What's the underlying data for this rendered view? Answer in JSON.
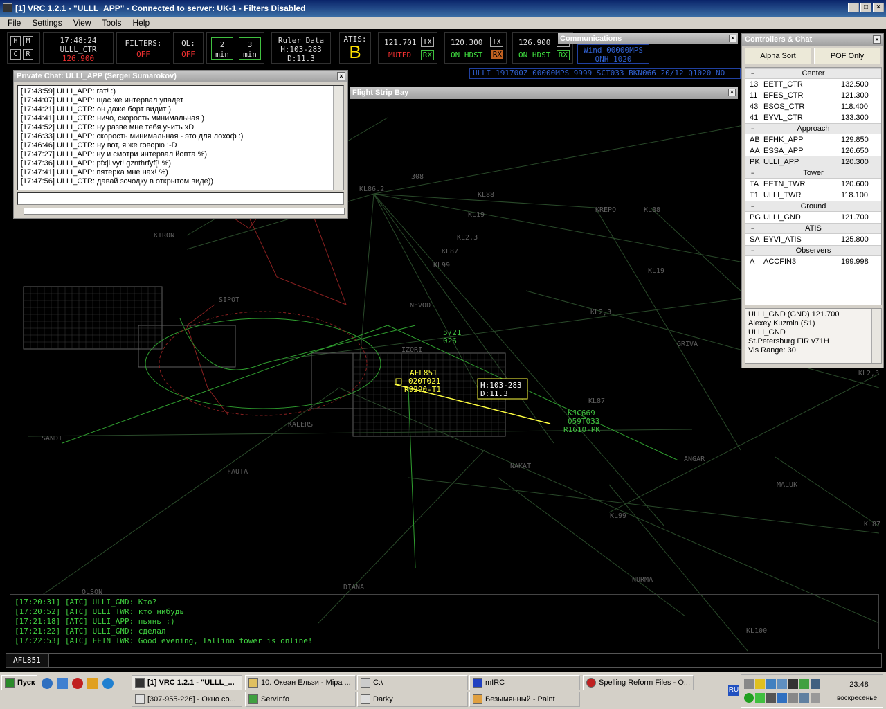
{
  "window": {
    "title": "[1] VRC 1.2.1 - \"ULLL_APP\" - Connected to server: UK-1 - Filters Disabled"
  },
  "menu": [
    "File",
    "Settings",
    "View",
    "Tools",
    "Help"
  ],
  "toolbar": {
    "keys": [
      "H",
      "M",
      "C",
      "R"
    ],
    "time": "17:48:24",
    "position": "ULLL_CTR",
    "position_freq": "126.900",
    "filters_label": "FILTERS:",
    "filters_value": "OFF",
    "ql_label": "QL:",
    "ql_value": "OFF",
    "min1": "2",
    "min1_unit": "min",
    "min2": "3",
    "min2_unit": "min",
    "ruler_label": "Ruler Data",
    "ruler_h": "H:103-283",
    "ruler_d": "D:11.3",
    "atis_label": "ATIS:",
    "atis_letter": "B",
    "freq1": "121.701",
    "freq1_status": "MUTED",
    "freq1_tx": "TX",
    "freq1_rx": "RX",
    "freq2": "120.300",
    "freq2_status": "ON HDST",
    "freq2_tx": "TX",
    "freq2_rx": "RX",
    "freq3": "126.900",
    "freq3_status": "ON HDST",
    "freq3_tx": "TX",
    "freq3_rx": "RX",
    "wind": "Wind 00000MPS",
    "qnh": "QNH 1020",
    "metar": "ULLI 191700Z 00000MPS 9999 SCT033 BKN066 20/12 Q1020 NO"
  },
  "communications": {
    "title": "Communications"
  },
  "flight_strip": {
    "title": "Flight Strip Bay"
  },
  "private_chat": {
    "title": "Private Chat: ULLI_APP (Sergei Sumarokov)",
    "messages": [
      "[17:43:59] ULLI_APP: гат! :)",
      "[17:44:07] ULLI_APP: щас же интервал упадет",
      "[17:44:21] ULLI_CTR: он даже борт видит )",
      "[17:44:41] ULLI_CTR: ничо, скорость минимальная )",
      "[17:44:52] ULLI_CTR: ну разве мне тебя учить xD",
      "[17:46:33] ULLI_APP: скорость минимальная - это для лохоф :)",
      "[17:46:46] ULLI_CTR: ну вот, я же говорю :-D",
      "[17:47:27] ULLI_APP: ну и смотри интервал йопта %)",
      "[17:47:36] ULLI_APP: pfxjl vyt! gznthrfyf[! %)",
      "[17:47:41] ULLI_APP: пятерка мне нах! %)",
      "[17:47:56] ULLI_CTR: давай зочодку в открытом виде))"
    ]
  },
  "controllers": {
    "title": "Controllers & Chat",
    "sort_button": "Alpha Sort",
    "pof_button": "POF Only",
    "groups": [
      {
        "name": "Center",
        "rows": [
          [
            "13",
            "EETT_CTR",
            "132.500"
          ],
          [
            "11",
            "EFES_CTR",
            "121.300"
          ],
          [
            "43",
            "ESOS_CTR",
            "118.400"
          ],
          [
            "41",
            "EYVL_CTR",
            "133.300"
          ]
        ]
      },
      {
        "name": "Approach",
        "rows": [
          [
            "AB",
            "EFHK_APP",
            "129.850"
          ],
          [
            "AA",
            "ESSA_APP",
            "126.650"
          ],
          [
            "PK",
            "ULLI_APP",
            "120.300"
          ]
        ]
      },
      {
        "name": "Tower",
        "rows": [
          [
            "TA",
            "EETN_TWR",
            "120.600"
          ],
          [
            "T1",
            "ULLI_TWR",
            "118.100"
          ]
        ]
      },
      {
        "name": "Ground",
        "rows": [
          [
            "PG",
            "ULLI_GND",
            "121.700"
          ]
        ]
      },
      {
        "name": "ATIS",
        "rows": [
          [
            "SA",
            "EYVI_ATIS",
            "125.800"
          ]
        ]
      },
      {
        "name": "Observers",
        "rows": [
          [
            "A",
            "ACCFIN3",
            "199.998"
          ]
        ]
      }
    ],
    "info": [
      "ULLI_GND (GND) 121.700",
      "Alexey Kuzmin (S1)",
      "ULLI_GND",
      "St.Petersburg FIR v71H",
      "Vis Range: 30"
    ]
  },
  "radar": {
    "fixes": [
      "KL86.2",
      "KL88",
      "KREPO",
      "KL88",
      "KL19",
      "KL2,3",
      "KL87",
      "KL99",
      "KIRON",
      "KL19",
      "SIPOT",
      "NEVOD",
      "KL2,3",
      "IZORI",
      "GRIVA",
      "SANDI",
      "KALERS",
      "NAKAT",
      "ANGAR",
      "FAUTA",
      "MALUK",
      "KL99",
      "KL87",
      "KL87",
      "NURMA",
      "DIANA",
      "OLSON",
      "KL100",
      "KL2,3",
      "308"
    ],
    "tag1": {
      "cs": "AFL851",
      "l2": "020T021",
      "l3": "R9290-T1"
    },
    "tag2": {
      "cs": "KJC669",
      "l2": "059T033",
      "l3": "R1610-PK"
    },
    "tag3": {
      "l1": "5721",
      "l2": "026"
    },
    "ruler_box": {
      "h": "H:103-283",
      "d": "D:11.3"
    }
  },
  "atc_log": [
    "[17:20:31] [ATC] ULLI_GND: Кто?",
    "[17:20:52] [ATC] ULLI_TWR: кто нибудь",
    "[17:21:18] [ATC] ULLI_APP: пьянь :)",
    "[17:21:22] [ATC] ULLI_GND: сделал",
    "[17:22:53] [ATC] EETN_TWR: Good evening, Tallinn tower is online!"
  ],
  "command": {
    "callsign": "AFL851"
  },
  "taskbar": {
    "start": "Пуск",
    "buttons": [
      "[1] VRC 1.2.1 - \"ULLL_...",
      "10. Океан Ельзи - Міра ...",
      "C:\\",
      "mIRC",
      "Spelling Reform Files - O...",
      "[307-955-226] - Окно со...",
      "ServInfo",
      "Darky",
      "Безымянный - Paint"
    ],
    "lang": "RU",
    "clock": "23:48",
    "day": "воскресенье"
  }
}
